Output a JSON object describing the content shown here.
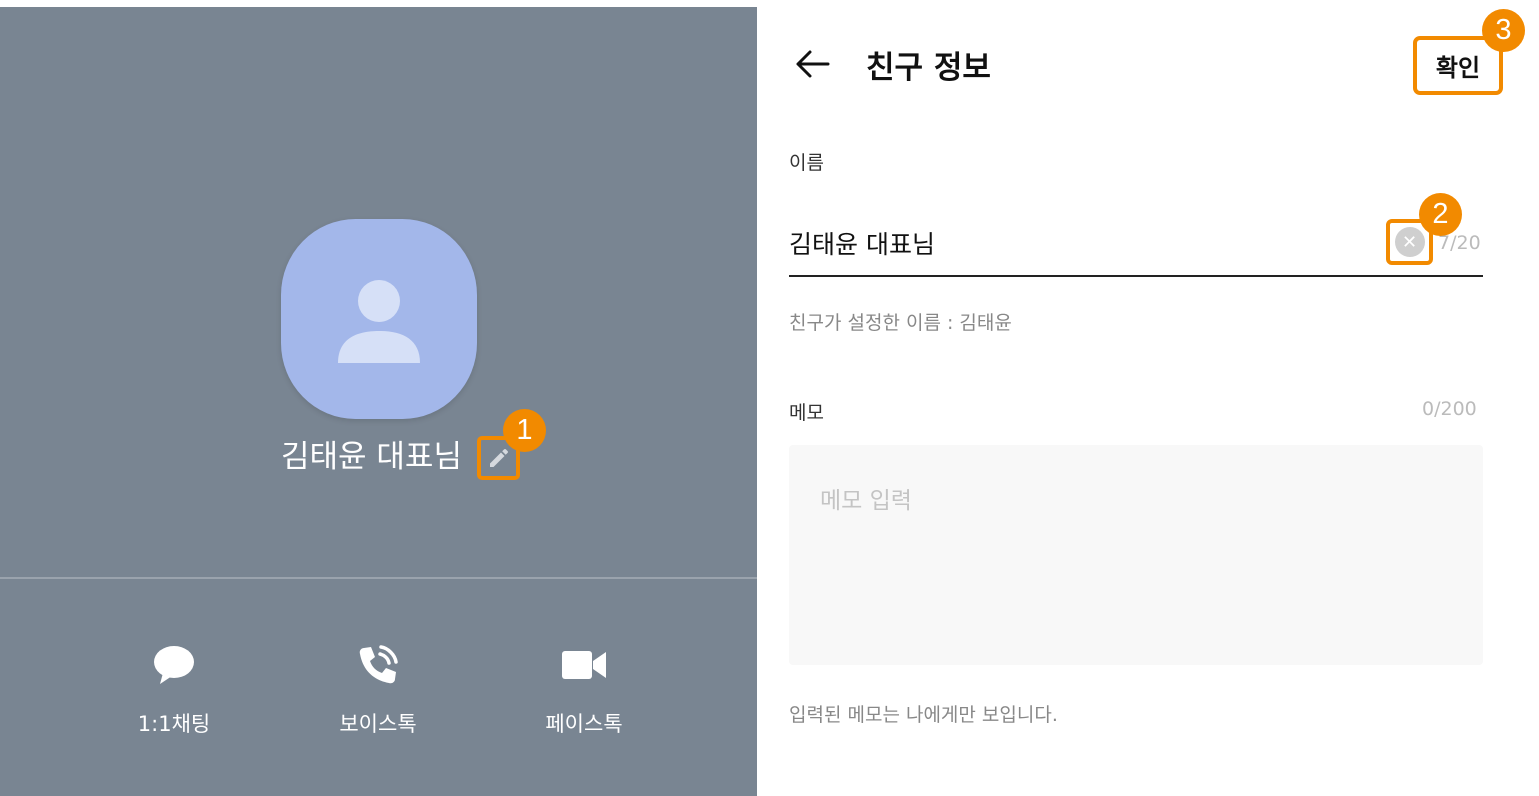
{
  "profile": {
    "name": "김태윤 대표님",
    "edit_icon": "pencil-icon",
    "avatar_icon": "person-silhouette-icon",
    "actions": [
      {
        "label": "1:1채팅",
        "icon": "chat-bubble-icon"
      },
      {
        "label": "보이스톡",
        "icon": "phone-call-icon"
      },
      {
        "label": "페이스톡",
        "icon": "video-camera-icon"
      }
    ]
  },
  "header": {
    "title": "친구 정보",
    "confirm_label": "확인",
    "back_icon": "arrow-left-icon"
  },
  "name_field": {
    "label": "이름",
    "value": "김태윤 대표님",
    "counter_visible": "7/20",
    "clear_icon": "clear-x-icon",
    "helper": "친구가 설정한 이름 : 김태윤"
  },
  "memo_field": {
    "label": "메모",
    "counter": "0/200",
    "placeholder": "메모 입력",
    "helper": "입력된 메모는 나에게만 보입니다."
  },
  "annotations": {
    "step1": "1",
    "step2": "2",
    "step3": "3",
    "color": "#f28a00"
  },
  "colors": {
    "profile_background": "#798592",
    "avatar": "#a3b7ea",
    "highlight": "#f28a00"
  }
}
